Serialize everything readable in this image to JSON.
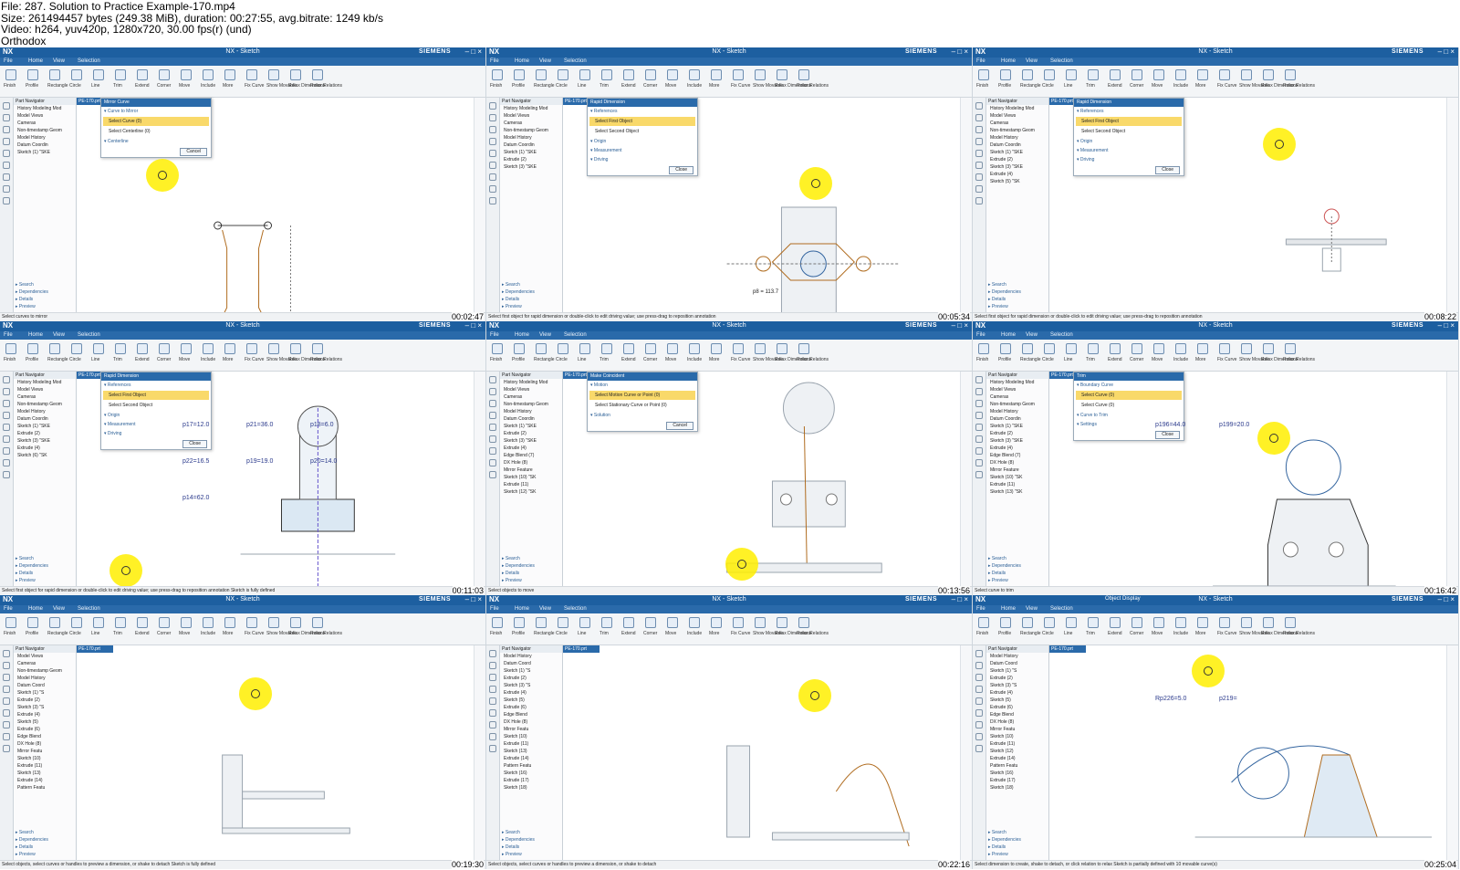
{
  "header": {
    "file_line": "File: 287. Solution to Practice Example-170.mp4",
    "size_line": "Size: 261494457 bytes (249.38 MiB), duration: 00:27:55, avg.bitrate: 1249 kb/s",
    "video_line": "Video: h264, yuv420p, 1280x720, 30.00 fps(r) (und)",
    "tag_line": "Orthodox"
  },
  "common": {
    "app_logo": "NX",
    "window_title": "NX - Sketch",
    "brand": "SIEMENS",
    "menu": [
      "File",
      "Home",
      "View",
      "Selection"
    ],
    "ribbon": [
      "Finish",
      "Profile",
      "Rectangle",
      "Circle",
      "Line",
      "Trim",
      "Extend",
      "Corner",
      "Move",
      "Include",
      "More",
      "Fix Curve",
      "Show Movable",
      "Relax Dimensions",
      "Relax Relations"
    ],
    "nav_title": "Part Navigator",
    "nav_sections": [
      "Search",
      "Dependencies",
      "Details",
      "Preview"
    ],
    "file_tab": "PE-170.prt"
  },
  "tiles": [
    {
      "timestamp": "00:02:47",
      "status": "Select curves to mirror",
      "dialog": {
        "title": "Mirror Curve",
        "sections": [
          "Curve to Mirror",
          "Centerline"
        ],
        "rows": [
          "Select Curve (0)",
          "Select Centerline (0)"
        ],
        "button": "Cancel"
      },
      "nav_items": [
        "History Modeling Mod",
        "Model Views",
        "Cameras",
        "Non-timestamp Geom",
        "Model History",
        "Datum Coordin",
        "Sketch (1) \"SKE"
      ]
    },
    {
      "timestamp": "00:05:34",
      "status": "Select first object for rapid dimension or double-click to edit driving value; use press-drag to reposition annotation",
      "dialog": {
        "title": "Rapid Dimension",
        "sections": [
          "References",
          "Origin",
          "Measurement",
          "Driving"
        ],
        "rows": [
          "Select First Object",
          "Select Second Object"
        ],
        "button": "Close"
      },
      "nav_items": [
        "History Modeling Mod",
        "Model Views",
        "Cameras",
        "Non-timestamp Geom",
        "Model History",
        "Datum Coordin",
        "Sketch (1) \"SKE",
        "Extrude (2)",
        "Sketch (3) \"SKE"
      ],
      "dimension": "p8 = 113.7"
    },
    {
      "timestamp": "00:08:22",
      "status": "Select first object for rapid dimension or double-click to edit driving value; use press-drag to reposition annotation",
      "dialog": {
        "title": "Rapid Dimension",
        "sections": [
          "References",
          "Origin",
          "Measurement",
          "Driving"
        ],
        "rows": [
          "Select First Object",
          "Select Second Object"
        ],
        "button": "Close"
      },
      "nav_items": [
        "History Modeling Mod",
        "Model Views",
        "Cameras",
        "Non-timestamp Geom",
        "Model History",
        "Datum Coordin",
        "Sketch (1) \"SKE",
        "Extrude (2)",
        "Sketch (3) \"SKE",
        "Extrude (4)",
        "Sketch (5) \"SK"
      ]
    },
    {
      "timestamp": "00:11:03",
      "status": "Select first object for rapid dimension or double-click to edit driving value; use press-drag to reposition annotation    Sketch is fully defined",
      "dialog": {
        "title": "Rapid Dimension",
        "sections": [
          "References",
          "Origin",
          "Measurement",
          "Driving"
        ],
        "rows": [
          "Select First Object",
          "Select Second Object"
        ],
        "button": "Close"
      },
      "nav_items": [
        "History Modeling Mod",
        "Model Views",
        "Cameras",
        "Non-timestamp Geom",
        "Model History",
        "Datum Coordin",
        "Sketch (1) \"SKE",
        "Extrude (2)",
        "Sketch (3) \"SKE",
        "Extrude (4)",
        "Sketch (6) \"SK"
      ],
      "dims": [
        "p17=12.0",
        "p21=36.0",
        "p18=6.0",
        "p22=16.5",
        "p19=19.0",
        "p20=14.0",
        "p14=62.0"
      ]
    },
    {
      "timestamp": "00:13:56",
      "status": "Select objects to move",
      "dialog": {
        "title": "Make Coincident",
        "sections": [
          "Motion",
          "Solution"
        ],
        "rows": [
          "Select Motion Curve or Point (0)",
          "Select Stationary Curve or Point (0)"
        ],
        "button": "Cancel"
      },
      "nav_items": [
        "History Modeling Mod",
        "Model Views",
        "Cameras",
        "Non-timestamp Geom",
        "Model History",
        "Datum Coordin",
        "Sketch (1) \"SKE",
        "Extrude (2)",
        "Sketch (3) \"SKE",
        "Extrude (4)",
        "Edge Blend (7)",
        "DX Hole (8)",
        "Mirror Feature",
        "Sketch (10) \"SK",
        "Extrude (11)",
        "Sketch (12) \"SK"
      ]
    },
    {
      "timestamp": "00:16:42",
      "status": "Select curve to trim",
      "dialog": {
        "title": "Trim",
        "sections": [
          "Boundary Curve",
          "Curve to Trim",
          "Settings"
        ],
        "rows": [
          "Select Curve (0)",
          "Select Curve (0)"
        ],
        "button": "Close"
      },
      "nav_items": [
        "History Modeling Mod",
        "Model Views",
        "Cameras",
        "Non-timestamp Geom",
        "Model History",
        "Datum Coordin",
        "Sketch (1) \"SKE",
        "Extrude (2)",
        "Sketch (3) \"SKE",
        "Extrude (4)",
        "Edge Blend (7)",
        "DX Hole (8)",
        "Mirror Feature",
        "Sketch (10) \"SK",
        "Extrude (11)",
        "Sketch (13) \"SK"
      ],
      "dims": [
        "p196=44.0",
        "p199=20.0"
      ]
    },
    {
      "timestamp": "00:19:30",
      "status": "Select objects, select curves or handles to preview a dimension, or shake to detach    Sketch is fully defined",
      "nav_items": [
        "Model Views",
        "Cameras",
        "Non-timestamp Geom",
        "Model History",
        "Datum Coord",
        "Sketch (1) \"S",
        "Extrude (2)",
        "Sketch (3) \"S",
        "Extrude (4)",
        "Sketch (5)",
        "Extrude (6)",
        "Edge Blend",
        "DX Hole (8)",
        "Mirror Featu",
        "Sketch (10)",
        "Extrude (11)",
        "Sketch (13)",
        "Extrude (14)",
        "Pattern Featu"
      ]
    },
    {
      "timestamp": "00:22:16",
      "status": "Select objects, select curves or handles to preview a dimension, or shake to detach",
      "nav_items": [
        "Model History",
        "Datum Coord",
        "Sketch (1) \"S",
        "Extrude (2)",
        "Sketch (3) \"S",
        "Extrude (4)",
        "Sketch (5)",
        "Extrude (6)",
        "Edge Blend",
        "DX Hole (8)",
        "Mirror Featu",
        "Sketch (10)",
        "Extrude (11)",
        "Sketch (13)",
        "Extrude (14)",
        "Pattern Featu",
        "Sketch (16)",
        "Extrude (17)",
        "Sketch (18)"
      ]
    },
    {
      "timestamp": "00:25:04",
      "status": "Select dimension to create, shake to detach, or click relation to relax    Sketch is partially defined with 10 movable curve(s)",
      "dialog_title": "Object Display",
      "nav_items": [
        "Model History",
        "Datum Coord",
        "Sketch (1) \"S",
        "Extrude (2)",
        "Sketch (3) \"S",
        "Extrude (4)",
        "Sketch (5)",
        "Extrude (6)",
        "Edge Blend",
        "DX Hole (8)",
        "Mirror Featu",
        "Sketch (10)",
        "Extrude (11)",
        "Sketch (12)",
        "Extrude (14)",
        "Pattern Featu",
        "Sketch (16)",
        "Extrude (17)",
        "Sketch (18)"
      ],
      "dims": [
        "Rp226=5.0",
        "p219="
      ]
    }
  ]
}
